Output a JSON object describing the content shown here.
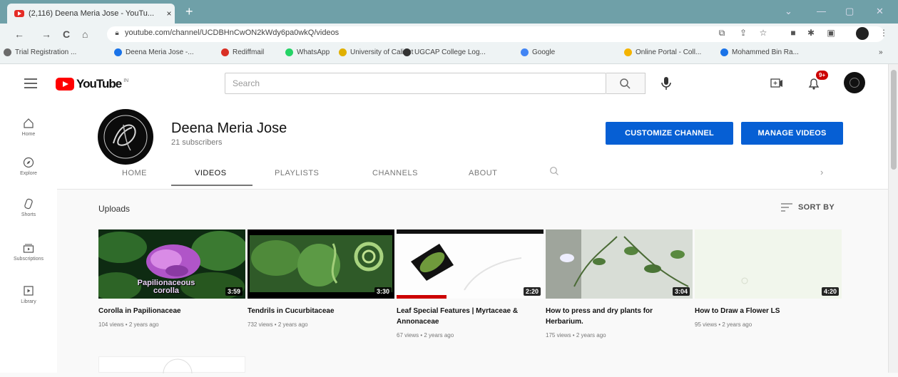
{
  "browser": {
    "tab_title": "(2,116) Deena Meria Jose - YouTu...",
    "tab_close": "×",
    "new_tab": "+",
    "url": "youtube.com/channel/UCDBHnCwON2kWdy6pa0wkQ/videos",
    "window_controls": [
      "⌄",
      "—",
      "▢",
      "✕"
    ],
    "bookmarks": [
      {
        "label": "Trial Registration ...",
        "color": "#6b6b6b"
      },
      {
        "label": "Deena Meria Jose -...",
        "color": "#1a73e8"
      },
      {
        "label": "Rediffmail",
        "color": "#d93025"
      },
      {
        "label": "WhatsApp",
        "color": "#25d366"
      },
      {
        "label": "University of Calicut",
        "color": "#e0b000"
      },
      {
        "label": "UGCAP College Log...",
        "color": "#333333"
      },
      {
        "label": "Google",
        "color": "#4285f4"
      },
      {
        "label": "Online Portal - Coll...",
        "color": "#f4b400"
      },
      {
        "label": "Mohammed Bin Ra...",
        "color": "#1a73e8"
      }
    ]
  },
  "youtube": {
    "logo_text": "YouTube",
    "logo_region": "IN",
    "search_placeholder": "Search",
    "notif_count": "9+"
  },
  "sidebar": [
    {
      "label": "Home",
      "icon": "home-icon"
    },
    {
      "label": "Explore",
      "icon": "compass-icon"
    },
    {
      "label": "Shorts",
      "icon": "shorts-icon"
    },
    {
      "label": "Subscriptions",
      "icon": "subscriptions-icon"
    },
    {
      "label": "Library",
      "icon": "library-icon"
    }
  ],
  "channel": {
    "name": "Deena Meria Jose",
    "subscribers": "21 subscribers",
    "customize_label": "CUSTOMIZE CHANNEL",
    "manage_label": "MANAGE VIDEOS",
    "tabs": [
      "HOME",
      "VIDEOS",
      "PLAYLISTS",
      "CHANNELS",
      "ABOUT"
    ],
    "active_tab": "VIDEOS"
  },
  "section": {
    "title": "Uploads",
    "sort_label": "SORT BY"
  },
  "videos": [
    {
      "title": "Corolla in Papilionaceae",
      "meta": "104 views • 2 years ago",
      "duration": "3:59",
      "overlay": "Papilionaceous corolla"
    },
    {
      "title": "Tendrils in Cucurbitaceae",
      "meta": "732 views • 2 years ago",
      "duration": "3:30"
    },
    {
      "title": "Leaf Special Features | Myrtaceae & Annonaceae",
      "meta": "67 views • 2 years ago",
      "duration": "2:20"
    },
    {
      "title": "How to press and dry plants for Herbarium.",
      "meta": "175 views • 2 years ago",
      "duration": "3:04"
    },
    {
      "title": "How to Draw a Flower LS",
      "meta": "95 views • 2 years ago",
      "duration": "4:20"
    }
  ],
  "colors": {
    "accent_blue": "#065fd4",
    "youtube_red": "#ff0000",
    "chrome_teal": "#6fa0a8"
  }
}
